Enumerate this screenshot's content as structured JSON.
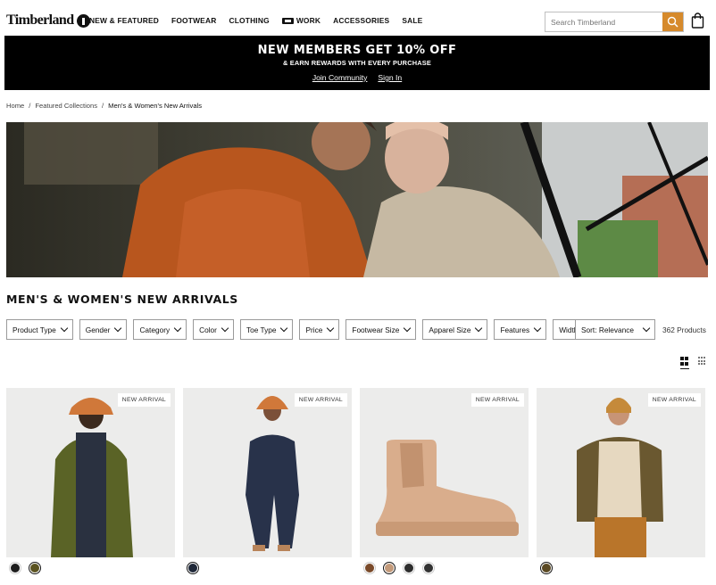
{
  "brand": {
    "name": "Timberland"
  },
  "nav": {
    "items": [
      "NEW & FEATURED",
      "FOOTWEAR",
      "CLOTHING",
      "WORK",
      "ACCESSORIES",
      "SALE"
    ]
  },
  "search": {
    "placeholder": "Search Timberland"
  },
  "promo": {
    "headline": "NEW MEMBERS GET 10% OFF",
    "sub": "& EARN REWARDS WITH EVERY PURCHASE",
    "link_join": "Join Community",
    "link_signin": "Sign In"
  },
  "breadcrumb": {
    "items": [
      "Home",
      "Featured Collections",
      "Men's & Women's New Arrivals"
    ]
  },
  "page": {
    "title": "MEN'S & WOMEN'S NEW ARRIVALS"
  },
  "filters": [
    "Product Type",
    "Gender",
    "Category",
    "Color",
    "Toe Type",
    "Price",
    "Footwear Size",
    "Apparel Size",
    "Features",
    "Width"
  ],
  "sort": {
    "label": "Sort: Relevance"
  },
  "results": {
    "count": "362 Products"
  },
  "products": [
    {
      "badge": "NEW ARRIVAL",
      "swatches": [
        "#1d1d1d",
        "#5b5320"
      ],
      "selected": 1
    },
    {
      "badge": "NEW ARRIVAL",
      "swatches": [
        "#1e2738"
      ],
      "selected": 0
    },
    {
      "badge": "NEW ARRIVAL",
      "swatches": [
        "#7a4a2a",
        "#c39a7a",
        "#2d2d2d",
        "#333333"
      ],
      "selected": 1
    },
    {
      "badge": "NEW ARRIVAL",
      "swatches": [
        "#5c4a24"
      ],
      "selected": 0
    }
  ],
  "colors": {
    "accent": "#d68a2c",
    "promo_bg": "#000000"
  }
}
